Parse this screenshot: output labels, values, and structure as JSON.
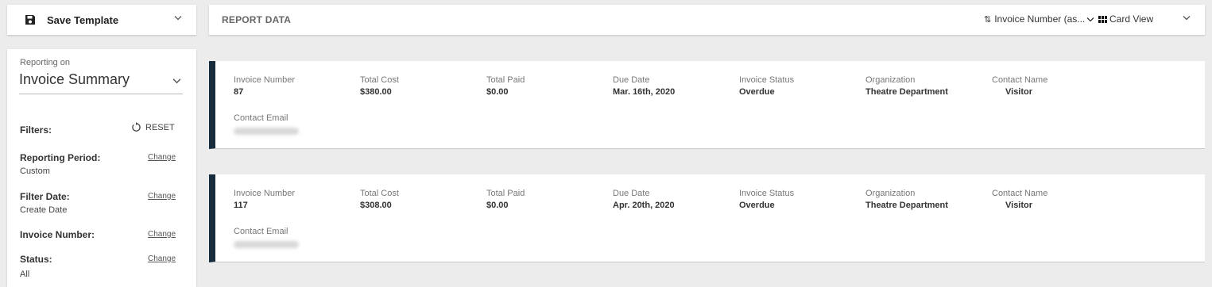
{
  "save_template": {
    "label": "Save Template"
  },
  "header": {
    "title": "REPORT DATA",
    "sort_label": "Invoice Number (as...",
    "view_label": "Card View"
  },
  "sidebar": {
    "reporting_on_label": "Reporting on",
    "reporting_on_value": "Invoice Summary",
    "filters_label": "Filters:",
    "reset_label": "RESET",
    "change_label": "Change",
    "filters": [
      {
        "label": "Reporting Period:",
        "value": "Custom"
      },
      {
        "label": "Filter Date:",
        "value": "Create Date"
      },
      {
        "label": "Invoice Number:",
        "value": ""
      },
      {
        "label": "Status:",
        "value": "All"
      }
    ]
  },
  "cards": [
    {
      "invoice_number_label": "Invoice Number",
      "invoice_number": "87",
      "total_cost_label": "Total Cost",
      "total_cost": "$380.00",
      "total_paid_label": "Total Paid",
      "total_paid": "$0.00",
      "due_date_label": "Due Date",
      "due_date": "Mar. 16th, 2020",
      "status_label": "Invoice Status",
      "status": "Overdue",
      "organization_label": "Organization",
      "organization": "Theatre Department",
      "contact_name_label": "Contact Name",
      "contact_name": "Visitor",
      "contact_email_label": "Contact Email"
    },
    {
      "invoice_number_label": "Invoice Number",
      "invoice_number": "117",
      "total_cost_label": "Total Cost",
      "total_cost": "$308.00",
      "total_paid_label": "Total Paid",
      "total_paid": "$0.00",
      "due_date_label": "Due Date",
      "due_date": "Apr. 20th, 2020",
      "status_label": "Invoice Status",
      "status": "Overdue",
      "organization_label": "Organization",
      "organization": "Theatre Department",
      "contact_name_label": "Contact Name",
      "contact_name": "Visitor",
      "contact_email_label": "Contact Email"
    }
  ],
  "colors": {
    "card_accent": "#172d3d",
    "background": "#ececec"
  }
}
